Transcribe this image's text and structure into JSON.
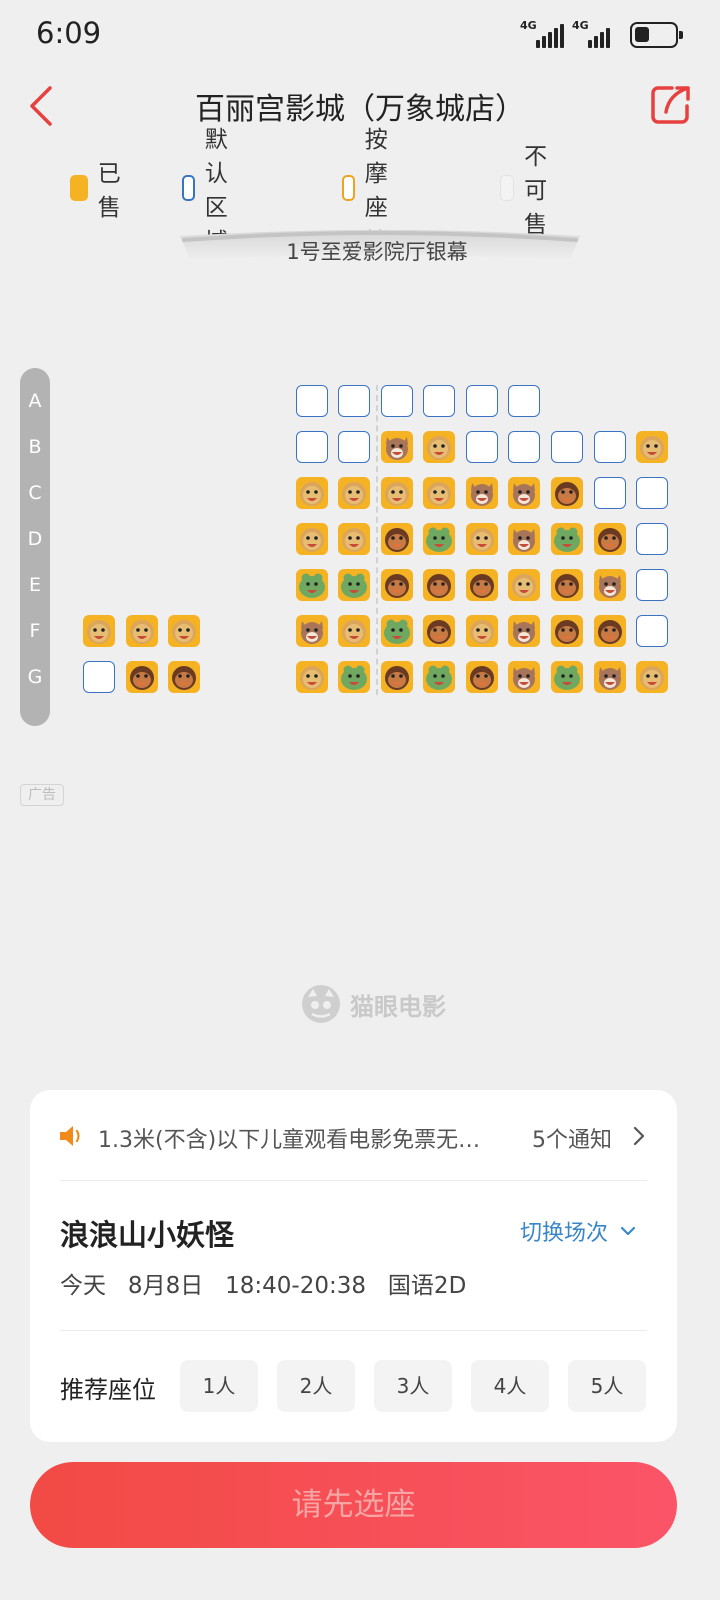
{
  "status_bar": {
    "time": "6:09",
    "network_1": "4G",
    "network_2": "4G",
    "battery_level": 0.35
  },
  "header": {
    "title": "百丽宫影城（万象城店）"
  },
  "legend": [
    {
      "label": "已售",
      "kind": "sold"
    },
    {
      "label": "默认区域",
      "kind": "std"
    },
    {
      "label": "按摩座椅",
      "kind": "massage"
    },
    {
      "label": "不可售",
      "kind": "na"
    }
  ],
  "screen": {
    "label": "1号至爱影院厅银幕"
  },
  "rows": [
    "A",
    "B",
    "C",
    "D",
    "E",
    "F",
    "G"
  ],
  "seat_map": {
    "A": [
      "",
      "",
      "",
      "",
      "",
      "",
      "empty",
      "empty",
      "empty",
      "empty",
      "empty",
      "empty",
      "",
      "",
      ""
    ],
    "B": [
      "",
      "",
      "",
      "",
      "",
      "",
      "empty",
      "empty",
      "wolf",
      "lion",
      "empty",
      "empty",
      "empty",
      "empty",
      "lion"
    ],
    "C": [
      "",
      "",
      "",
      "",
      "",
      "",
      "lion",
      "lion",
      "lion",
      "lion",
      "wolf",
      "wolf",
      "monkey",
      "empty",
      "empty"
    ],
    "D": [
      "",
      "",
      "",
      "",
      "",
      "",
      "lion",
      "lion",
      "monkey",
      "frog",
      "lion",
      "wolf",
      "frog",
      "monkey",
      "empty"
    ],
    "E": [
      "",
      "",
      "",
      "",
      "",
      "",
      "frog",
      "frog",
      "monkey",
      "monkey",
      "monkey",
      "lion",
      "monkey",
      "wolf",
      "empty"
    ],
    "F": [
      "lion",
      "lion",
      "lion",
      "",
      "",
      "",
      "wolf",
      "lion",
      "frog",
      "monkey",
      "lion",
      "wolf",
      "monkey",
      "monkey",
      "empty"
    ],
    "G": [
      "empty",
      "monkey",
      "monkey",
      "",
      "",
      "",
      "lion",
      "frog",
      "monkey",
      "frog",
      "monkey",
      "wolf",
      "frog",
      "wolf",
      "lion"
    ]
  },
  "ad_label": "广告",
  "watermark": "猫眼电影",
  "notice": {
    "text": "1.3米(不含)以下儿童观看电影免票无…",
    "count": "5个通知"
  },
  "movie": {
    "title": "浪浪山小妖怪",
    "switch_label": "切换场次",
    "showtime": "今天   8月8日   18:40-20:38   国语2D"
  },
  "recommend": {
    "label": "推荐座位",
    "options": [
      "1人",
      "2人",
      "3人",
      "4人",
      "5人"
    ]
  },
  "cta": {
    "label": "请先选座"
  },
  "colors": {
    "accent": "#f24a44",
    "seat_border": "#3a73c4",
    "sold_bg": "#f5b324",
    "link_blue": "#3a87c8"
  }
}
